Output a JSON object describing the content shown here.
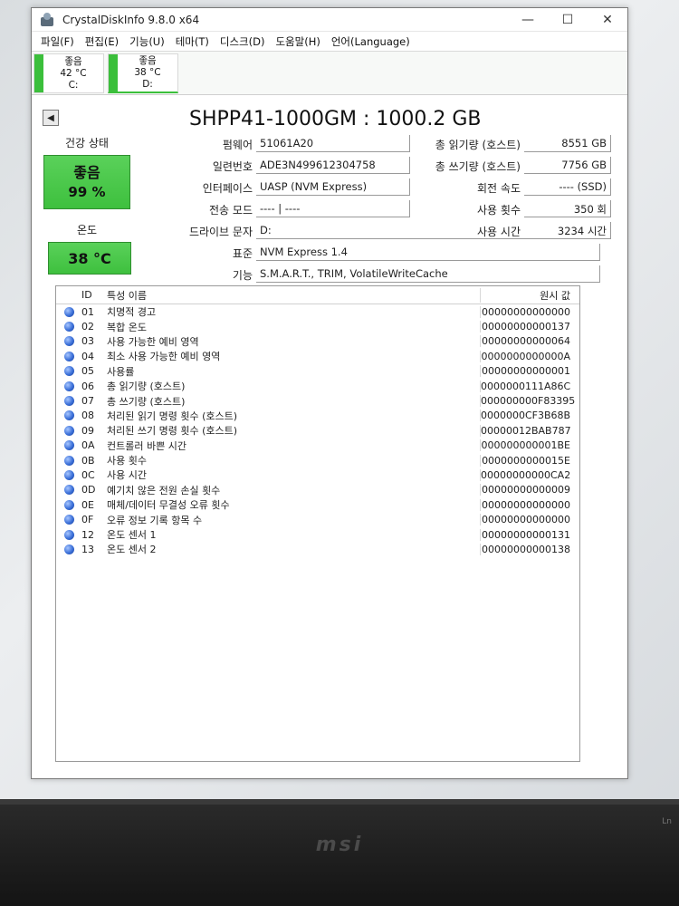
{
  "window": {
    "title": "CrystalDiskInfo 9.8.0 x64",
    "controls": [
      "—",
      "☐",
      "✕"
    ]
  },
  "menu": [
    "파일(F)",
    "편집(E)",
    "기능(U)",
    "테마(T)",
    "디스크(D)",
    "도움말(H)",
    "언어(Language)"
  ],
  "drives": [
    {
      "status": "좋음",
      "temp": "42 °C",
      "letter": "C:"
    },
    {
      "status": "좋음",
      "temp": "38 °C",
      "letter": "D:"
    }
  ],
  "model": "SHPP41-1000GM : 1000.2 GB",
  "health": {
    "label": "건강 상태",
    "status": "좋음",
    "percent": "99 %"
  },
  "temperature": {
    "label": "온도",
    "value": "38 °C"
  },
  "info": {
    "firmware_label": "펌웨어",
    "firmware": "51061A20",
    "serial_label": "일련번호",
    "serial": "ADE3N499612304758",
    "interface_label": "인터페이스",
    "interface": "UASP (NVM Express)",
    "transfer_label": "전송 모드",
    "transfer": "---- | ----",
    "drive_letter_label": "드라이브 문자",
    "drive_letter": "D:",
    "standard_label": "표준",
    "standard": "NVM Express 1.4",
    "features_label": "기능",
    "features": "S.M.A.R.T., TRIM, VolatileWriteCache",
    "host_reads_label": "총 읽기량 (호스트)",
    "host_reads": "8551 GB",
    "host_writes_label": "총 쓰기량 (호스트)",
    "host_writes": "7756 GB",
    "rotation_label": "회전 속도",
    "rotation": "---- (SSD)",
    "power_count_label": "사용 횟수",
    "power_count": "350 회",
    "power_hours_label": "사용 시간",
    "power_hours": "3234 시간"
  },
  "attributes": {
    "headers": {
      "id": "ID",
      "name": "특성 이름",
      "raw": "원시 값"
    },
    "rows": [
      {
        "id": "01",
        "name": "치명적 경고",
        "raw": "00000000000000"
      },
      {
        "id": "02",
        "name": "복합 온도",
        "raw": "00000000000137"
      },
      {
        "id": "03",
        "name": "사용 가능한 예비 영역",
        "raw": "00000000000064"
      },
      {
        "id": "04",
        "name": "최소 사용 가능한 예비 영역",
        "raw": "0000000000000A"
      },
      {
        "id": "05",
        "name": "사용률",
        "raw": "00000000000001"
      },
      {
        "id": "06",
        "name": "총 읽기량 (호스트)",
        "raw": "0000000111A86C"
      },
      {
        "id": "07",
        "name": "총 쓰기량 (호스트)",
        "raw": "000000000F83395"
      },
      {
        "id": "08",
        "name": "처리된 읽기 명령 횟수 (호스트)",
        "raw": "0000000CF3B68B"
      },
      {
        "id": "09",
        "name": "처리된 쓰기 명령 횟수 (호스트)",
        "raw": "00000012BAB787"
      },
      {
        "id": "0A",
        "name": "컨트롤러 바쁜 시간",
        "raw": "000000000001BE"
      },
      {
        "id": "0B",
        "name": "사용 횟수",
        "raw": "0000000000015E"
      },
      {
        "id": "0C",
        "name": "사용 시간",
        "raw": "00000000000CA2"
      },
      {
        "id": "0D",
        "name": "예기치 않은 전원 손실 횟수",
        "raw": "00000000000009"
      },
      {
        "id": "0E",
        "name": "매체/데이터 무결성 오류 횟수",
        "raw": "00000000000000"
      },
      {
        "id": "0F",
        "name": "오류 정보 기록 항목 수",
        "raw": "00000000000000"
      },
      {
        "id": "12",
        "name": "온도 센서 1",
        "raw": "00000000000131"
      },
      {
        "id": "13",
        "name": "온도 센서 2",
        "raw": "00000000000138"
      }
    ]
  },
  "bezel": {
    "brand": "msi",
    "corner": "Ln"
  },
  "colors": {
    "good": "#3ec03e",
    "attribute_dot": "#3a6fd8"
  }
}
